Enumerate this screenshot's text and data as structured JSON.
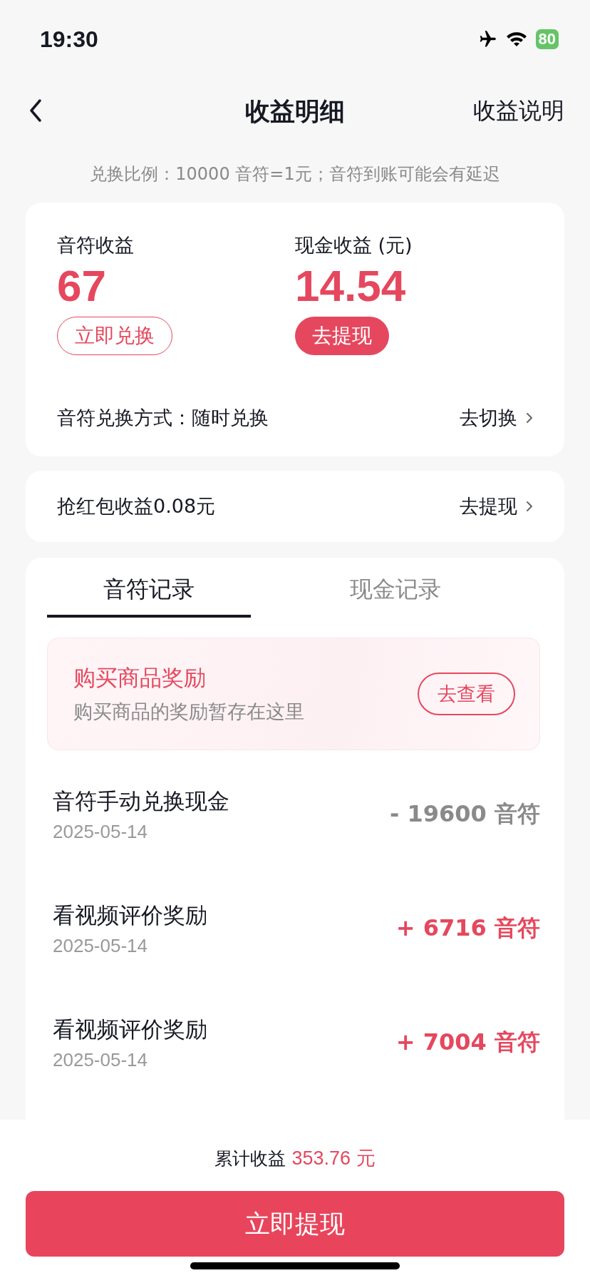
{
  "status_bar": {
    "time": "19:30",
    "battery": "80"
  },
  "nav": {
    "title": "收益明细",
    "action": "收益说明"
  },
  "notice": "兑换比例：10000 音符=1元；音符到账可能会有延迟",
  "earnings": {
    "columns": [
      {
        "label": "音符收益",
        "value": "67",
        "button": {
          "label": "立即兑换",
          "kind": "outline"
        }
      },
      {
        "label": "现金收益 (元)",
        "value": "14.54",
        "button": {
          "label": "去提现",
          "kind": "filled"
        }
      }
    ],
    "method": {
      "text": "音符兑换方式：随时兑换",
      "link": "去切换"
    }
  },
  "red_packet": {
    "text": "抢红包收益0.08元",
    "link": "去提现"
  },
  "tabs": [
    {
      "label": "音符记录",
      "selected": true
    },
    {
      "label": "现金记录",
      "selected": false
    }
  ],
  "promo": {
    "title": "购买商品奖励",
    "subtitle": "购买商品的奖励暂存在这里",
    "button": "去查看"
  },
  "records": [
    {
      "title": "音符手动兑换现金",
      "date": "2025-05-14",
      "amount": "- 19600 音符",
      "kind": "debit"
    },
    {
      "title": "看视频评价奖励",
      "date": "2025-05-14",
      "amount": "+ 6716 音符",
      "kind": "credit"
    },
    {
      "title": "看视频评价奖励",
      "date": "2025-05-14",
      "amount": "+ 7004 音符",
      "kind": "credit"
    }
  ],
  "footer": {
    "total_label": "累计收益",
    "total_value": "353.76 元",
    "button": "立即提现"
  }
}
